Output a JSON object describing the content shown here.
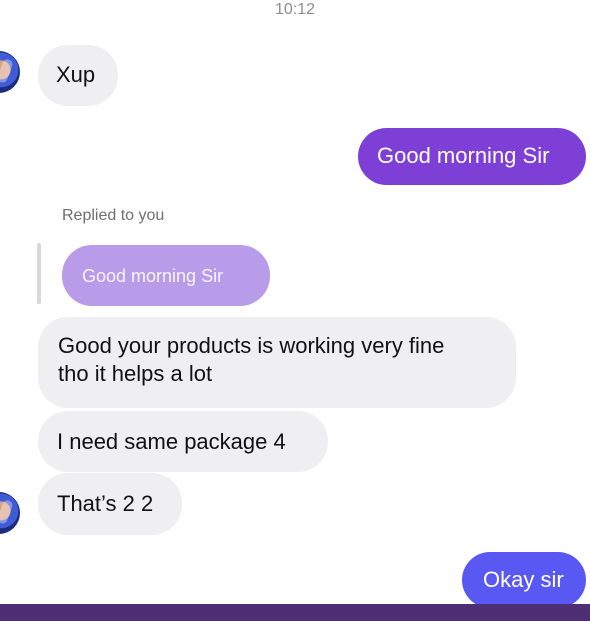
{
  "header": {
    "timestamp": "10:12"
  },
  "messages": {
    "m1": {
      "text": "Xup",
      "direction": "incoming"
    },
    "m2": {
      "text": "Good morning Sir",
      "direction": "outgoing"
    },
    "reply": {
      "label": "Replied to you",
      "quoted_text": "Good morning Sir"
    },
    "m3": {
      "line1": "Good your products is working very fine",
      "line2": "tho it helps a lot",
      "direction": "incoming"
    },
    "m4": {
      "text": "I need same package 4",
      "direction": "incoming"
    },
    "m5": {
      "text": "That’s 2 2",
      "direction": "incoming"
    },
    "m6": {
      "text": "Okay sir",
      "direction": "outgoing"
    }
  },
  "colors": {
    "incoming_bubble": "#efeff1",
    "outgoing_purple": "#7d3fd6",
    "outgoing_blue": "#5a58f2",
    "quoted_bubble": "#b89be9",
    "bottom_bar": "#4e2f75"
  },
  "icons": {
    "avatar": "avatar-icon"
  }
}
